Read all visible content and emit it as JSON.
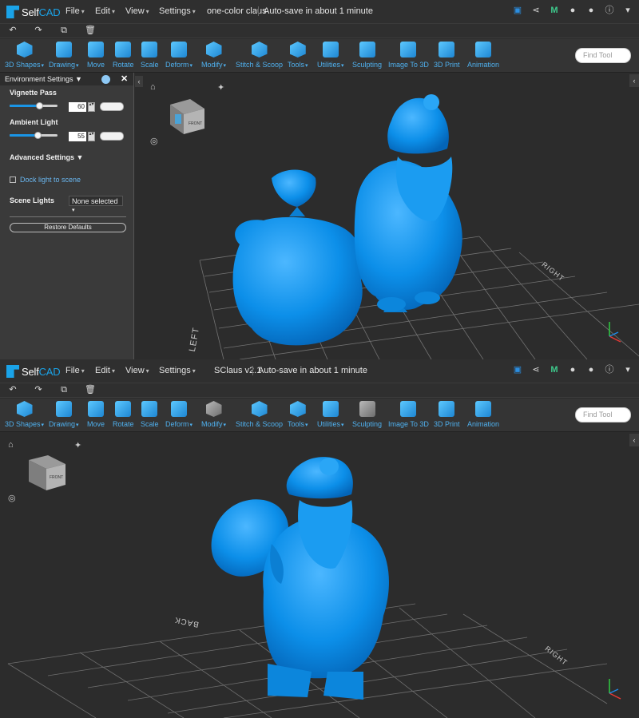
{
  "screens": [
    {
      "doc_title": "one-color claus",
      "autosave": "Auto-save in about 1 minute",
      "menus": [
        "File",
        "Edit",
        "View",
        "Settings"
      ],
      "tools": [
        "3D Shapes",
        "Drawing",
        "Move",
        "Rotate",
        "Scale",
        "Deform",
        "Modify",
        "Stitch & Scoop",
        "Tools",
        "Utilities",
        "Sculpting",
        "Image To 3D",
        "3D Print",
        "Animation"
      ],
      "find_placeholder": "Find Tool",
      "view_labels": {
        "left": "LEFT",
        "right": "RIGHT",
        "front": "FRONT"
      },
      "panel": {
        "title": "Environment Settings",
        "vignette_label": "Vignette Pass",
        "vignette_value": "60",
        "ambient_label": "Ambient Light",
        "ambient_value": "55",
        "advanced": "Advanced Settings",
        "dock": "Dock light to scene",
        "scene_lights_label": "Scene Lights",
        "scene_lights_value": "None selected",
        "restore": "Restore Defaults"
      }
    },
    {
      "doc_title": "SClaus v2.1",
      "autosave": "Auto-save in about 1 minute",
      "menus": [
        "File",
        "Edit",
        "View",
        "Settings"
      ],
      "tools": [
        "3D Shapes",
        "Drawing",
        "Move",
        "Rotate",
        "Scale",
        "Deform",
        "Modify",
        "Stitch & Scoop",
        "Tools",
        "Utilities",
        "Sculpting",
        "Image To 3D",
        "3D Print",
        "Animation"
      ],
      "find_placeholder": "Find Tool",
      "view_labels": {
        "back": "BACK",
        "right": "RIGHT",
        "front": "FRONT"
      }
    }
  ],
  "brand": {
    "name_a": "Self",
    "name_b": "CAD",
    "accent": "#1aa3e8",
    "model_color": "#0f8fea"
  },
  "icons": [
    "save-icon",
    "share-icon",
    "m-icon",
    "bell-icon",
    "user-icon",
    "info-icon",
    "chevron-down-icon",
    "undo-icon",
    "redo-icon",
    "copy-icon",
    "trash-icon",
    "home-icon",
    "light-icon",
    "orbit-icon"
  ]
}
